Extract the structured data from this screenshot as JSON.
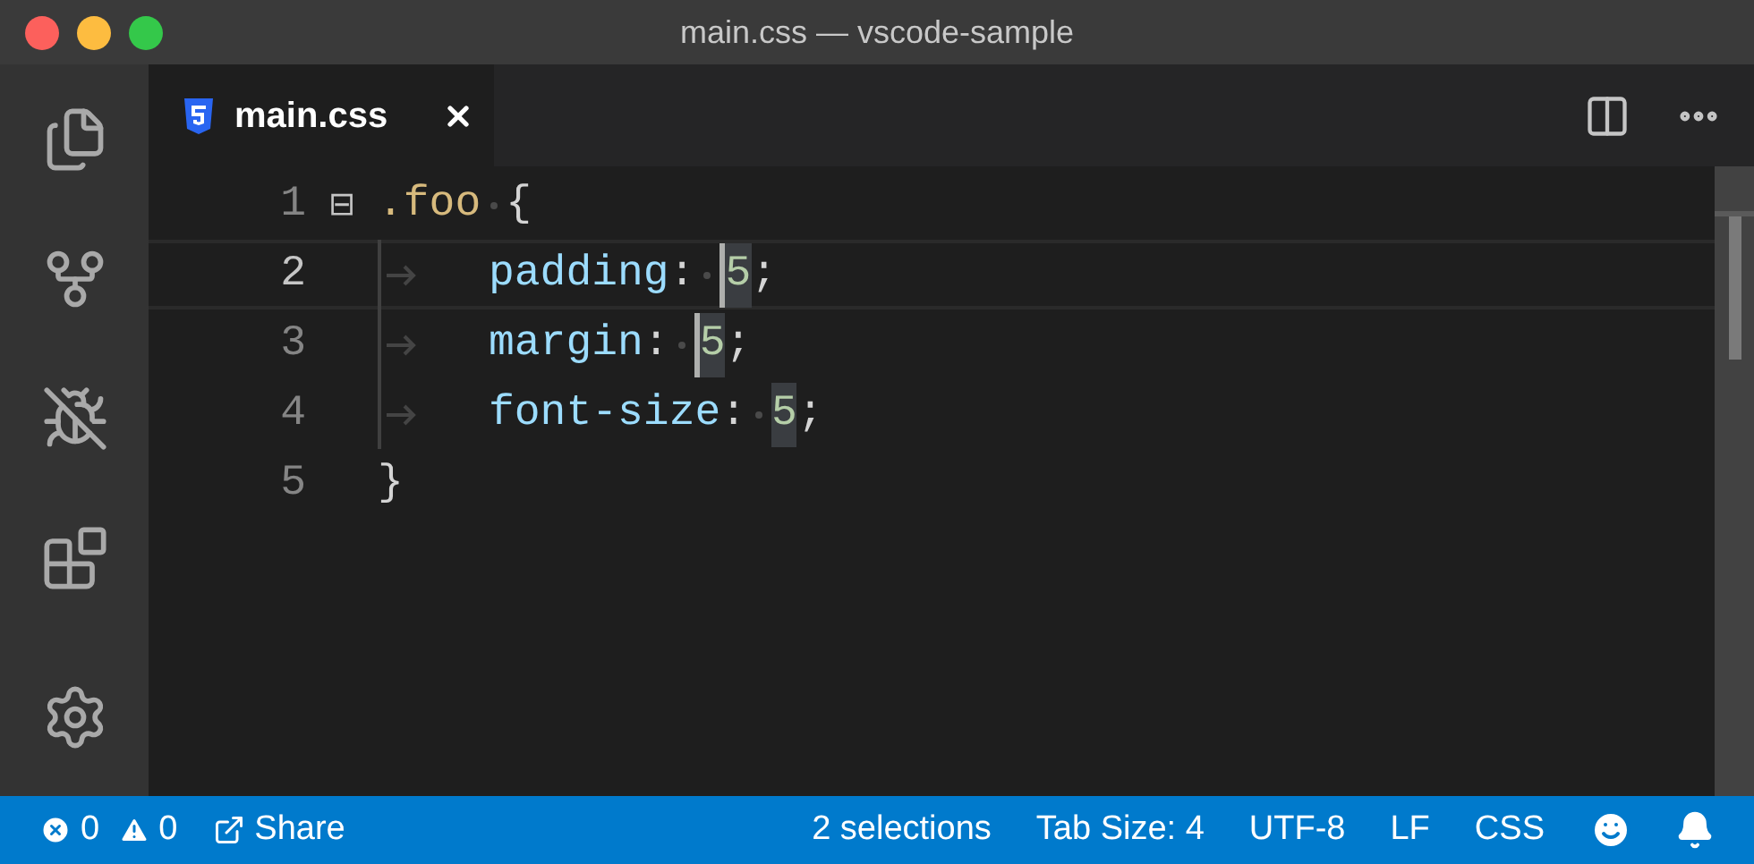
{
  "window": {
    "title": "main.css — vscode-sample"
  },
  "activity_bar": [
    {
      "kind": "explorer",
      "selected": false
    },
    {
      "kind": "scm",
      "selected": false
    },
    {
      "kind": "debug",
      "selected": false
    },
    {
      "kind": "extensions",
      "selected": false
    },
    {
      "kind": "settings",
      "selected": false
    }
  ],
  "tabs": [
    {
      "label": "main.css",
      "selected": true
    }
  ],
  "editor": {
    "lines": [
      {
        "number": "1",
        "current": false,
        "fold": "⊟",
        "indent": false,
        "tokens": [
          {
            "kind": "selector",
            "text": ".foo",
            "space_after": true
          },
          {
            "kind": "punct",
            "text": "{"
          }
        ]
      },
      {
        "number": "2",
        "current": true,
        "indent": true,
        "tokens": [
          {
            "kind": "property",
            "text": "padding"
          },
          {
            "kind": "punct",
            "text": ":",
            "space_after": true
          },
          {
            "kind": "number",
            "text": "5",
            "cursor": true,
            "highlighted": true
          },
          {
            "kind": "punct",
            "text": ";"
          }
        ]
      },
      {
        "number": "3",
        "current": false,
        "indent": true,
        "tokens": [
          {
            "kind": "property",
            "text": "margin"
          },
          {
            "kind": "punct",
            "text": ":",
            "space_after": true
          },
          {
            "kind": "number",
            "text": "5",
            "cursor": true,
            "highlighted": true
          },
          {
            "kind": "punct",
            "text": ";"
          }
        ]
      },
      {
        "number": "4",
        "current": false,
        "indent": true,
        "tokens": [
          {
            "kind": "property",
            "text": "font-size"
          },
          {
            "kind": "punct",
            "text": ":",
            "space_after": true
          },
          {
            "kind": "number",
            "text": "5",
            "cursor": false,
            "highlighted": true
          },
          {
            "kind": "punct",
            "text": ";"
          }
        ]
      },
      {
        "number": "5",
        "current": false,
        "indent": false,
        "tokens": [
          {
            "kind": "punct",
            "text": "}"
          }
        ]
      }
    ]
  },
  "status_bar": {
    "errors": "0",
    "warnings": "0",
    "share": "Share",
    "items": [
      "2 selections",
      "Tab Size: 4",
      "UTF-8",
      "LF",
      "CSS"
    ]
  }
}
